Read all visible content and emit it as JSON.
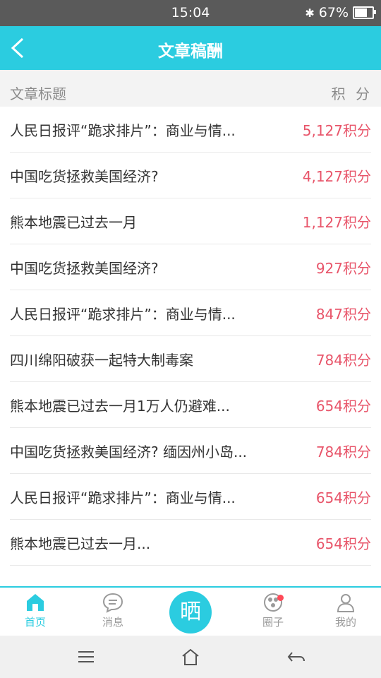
{
  "status_bar": {
    "time": "15:04",
    "bluetooth_icon": "bluetooth-icon",
    "battery_percent_label": "67%",
    "battery_level": 0.67
  },
  "header": {
    "title": "文章稿酬",
    "back_icon": "back-arrow-icon"
  },
  "column_headers": {
    "title": "文章标题",
    "score": "积 分"
  },
  "articles": [
    {
      "title": "人民日报评“跪求排片”：商业与情...",
      "score": "5,127积分"
    },
    {
      "title": "中国吃货拯救美国经济?",
      "score": "4,127积分"
    },
    {
      "title": "熊本地震已过去一月",
      "score": "1,127积分"
    },
    {
      "title": "中国吃货拯救美国经济?",
      "score": "927积分"
    },
    {
      "title": "人民日报评“跪求排片”：商业与情...",
      "score": "847积分"
    },
    {
      "title": "四川绵阳破获一起特大制毒案",
      "score": "784积分"
    },
    {
      "title": "熊本地震已过去一月1万人仍避难...",
      "score": "654积分"
    },
    {
      "title": "中国吃货拯救美国经济? 缅因州小岛...",
      "score": "784积分"
    },
    {
      "title": "人民日报评“跪求排片”：商业与情...",
      "score": "654积分"
    },
    {
      "title": "熊本地震已过去一月...",
      "score": "654积分"
    }
  ],
  "tabs": {
    "home": {
      "label": "首页",
      "icon": "home-icon"
    },
    "messages": {
      "label": "消息",
      "icon": "chat-bubble-icon"
    },
    "center": {
      "label": "晒"
    },
    "circle": {
      "label": "圈子",
      "icon": "circle-globe-icon"
    },
    "mine": {
      "label": "我的",
      "icon": "user-icon"
    }
  },
  "colors": {
    "accent": "#2bcce0",
    "score": "#e8556a",
    "status_bar": "#5a5a5a",
    "badge": "#ff4a58"
  }
}
